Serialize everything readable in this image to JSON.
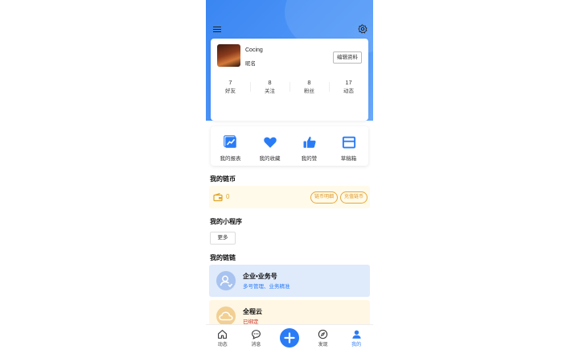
{
  "colors": {
    "accent": "#2a7cf6",
    "coin": "#e0a62a",
    "coin_bg": "#fffaea",
    "chain_blue_bg": "#dfeafb",
    "chain_yellow_bg": "#fff7e3"
  },
  "header": {
    "menu_icon": "hamburger-menu-icon",
    "settings_icon": "settings-gear-icon"
  },
  "profile": {
    "name": "Cocing",
    "subtitle": "昵名",
    "edit_label": "编辑资料",
    "stats": [
      {
        "count": "7",
        "label": "好友"
      },
      {
        "count": "8",
        "label": "关注"
      },
      {
        "count": "8",
        "label": "粉丝"
      },
      {
        "count": "17",
        "label": "动态"
      }
    ]
  },
  "quick_actions": [
    {
      "label": "我的报表",
      "icon": "chart-icon"
    },
    {
      "label": "我的收藏",
      "icon": "heart-icon"
    },
    {
      "label": "我的赞",
      "icon": "thumbs-up-icon"
    },
    {
      "label": "草稿箱",
      "icon": "drafts-box-icon"
    }
  ],
  "coins": {
    "title": "我的链币",
    "value": "0",
    "btn_detail": "链币明细",
    "btn_recharge": "充值链币"
  },
  "mini_programs": {
    "title": "我的小程序",
    "more_label": "更多"
  },
  "chains": {
    "title": "我的链链",
    "items": [
      {
        "title": "企业•业务号",
        "subtitle": "多号管理、业务精准"
      },
      {
        "title": "全程云",
        "subtitle": "已绑定"
      }
    ]
  },
  "tabbar": {
    "tabs": [
      {
        "label": "动态",
        "icon": "home-icon"
      },
      {
        "label": "消息",
        "icon": "chat-bubble-icon"
      },
      {
        "label": "",
        "icon": "plus-icon"
      },
      {
        "label": "发现",
        "icon": "compass-icon"
      },
      {
        "label": "我的",
        "icon": "user-icon"
      }
    ],
    "active_index": 4
  }
}
